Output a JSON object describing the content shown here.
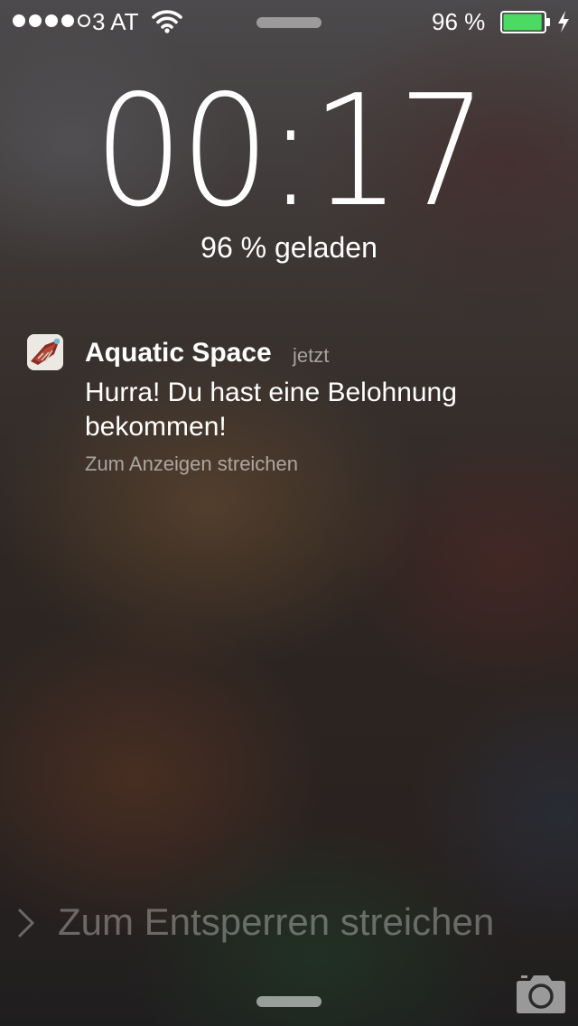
{
  "status_bar": {
    "signal_bars_filled": 4,
    "signal_bars_total": 5,
    "carrier": "3 AT",
    "wifi_icon": "wifi-icon",
    "battery_percent": "96 %",
    "battery_level": 0.96,
    "battery_color": "#4cd964",
    "charging_icon": "bolt-icon"
  },
  "lockscreen": {
    "time": "00:17",
    "charge_status": "96 % geladen"
  },
  "notification": {
    "app_icon": "aquatic-space-app-icon",
    "app_name": "Aquatic Space",
    "time": "jetzt",
    "message": "Hurra! Du hast eine Belohnung bekommen!",
    "hint": "Zum Anzeigen streichen"
  },
  "unlock": {
    "chevron_icon": "chevron-right-icon",
    "text": "Zum Entsperren streichen"
  },
  "camera": {
    "icon": "camera-icon"
  }
}
